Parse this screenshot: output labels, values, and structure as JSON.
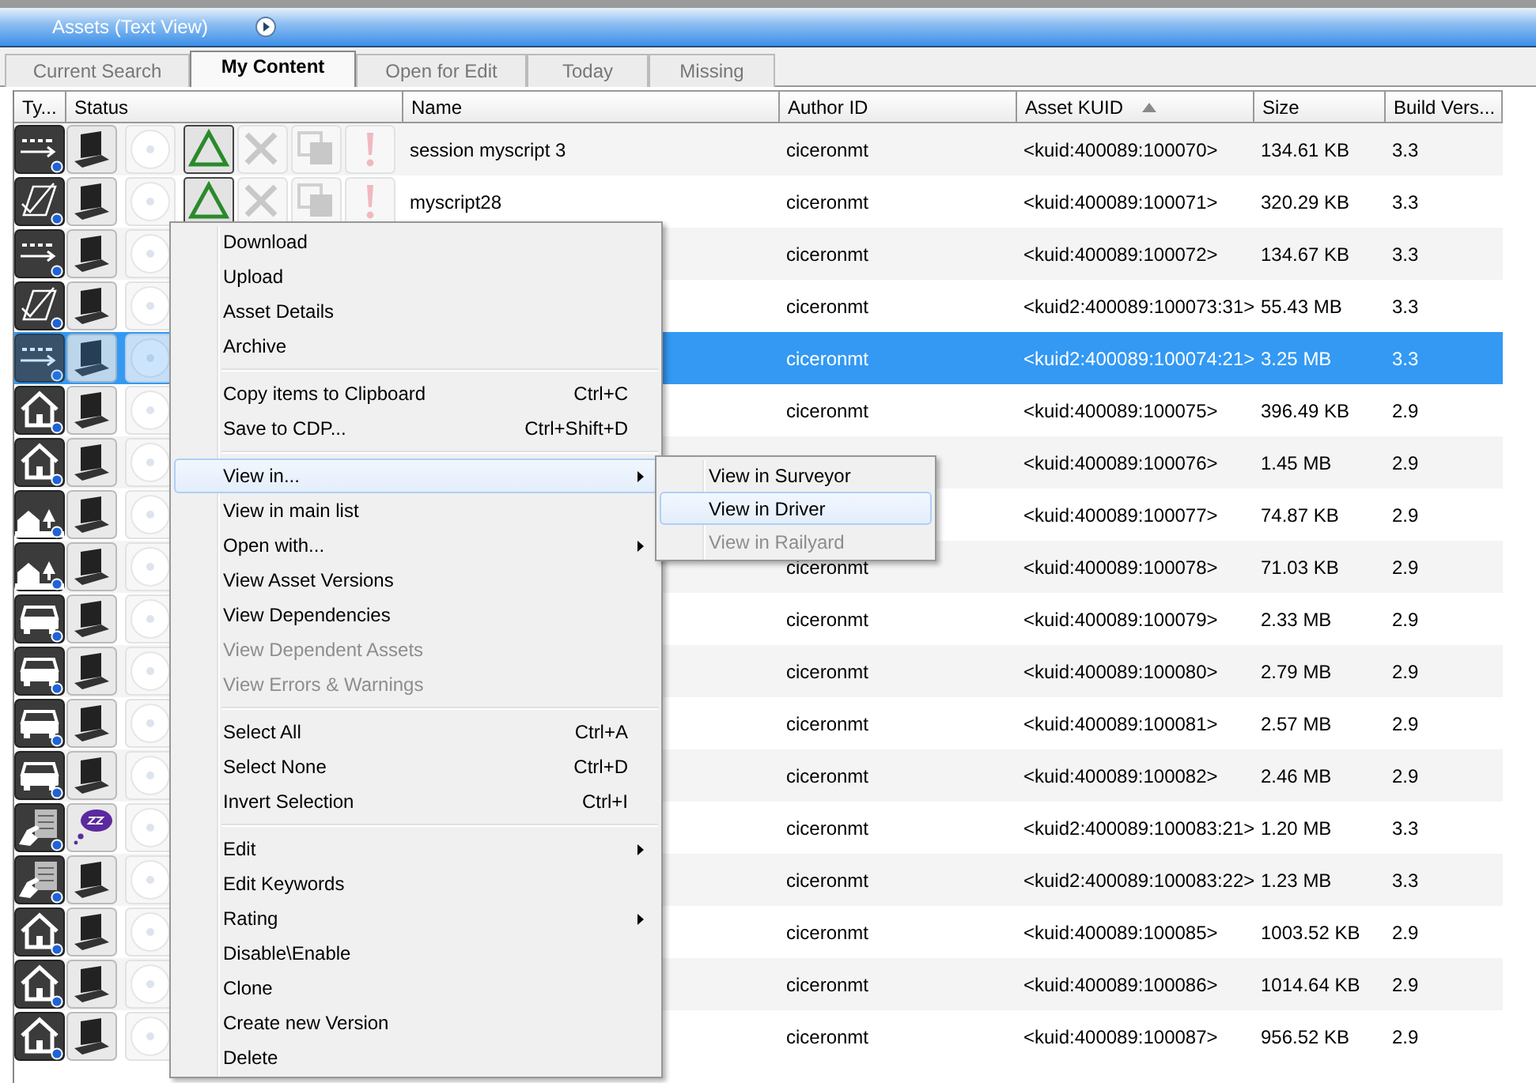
{
  "window": {
    "title": "Assets (Text View)"
  },
  "tabs": [
    {
      "label": "Current Search",
      "selected": false
    },
    {
      "label": "My Content",
      "selected": true
    },
    {
      "label": "Open for Edit",
      "selected": false
    },
    {
      "label": "Today",
      "selected": false
    },
    {
      "label": "Missing",
      "selected": false
    }
  ],
  "table": {
    "columns": [
      {
        "label": "Ty...",
        "sorted": false
      },
      {
        "label": "Status",
        "sorted": false
      },
      {
        "label": "Name",
        "sorted": false
      },
      {
        "label": "Author ID",
        "sorted": false
      },
      {
        "label": "Asset KUID",
        "sorted": true
      },
      {
        "label": "Size",
        "sorted": false
      },
      {
        "label": "Build Vers...",
        "sorted": false
      }
    ],
    "rows": [
      {
        "type_icon": {
          "kind": "script"
        },
        "status_icons": [
          {
            "kind": "laptop"
          },
          {
            "kind": "disc"
          },
          {
            "kind": "triangle"
          },
          {
            "kind": "tools"
          },
          {
            "kind": "copy"
          },
          {
            "kind": "warning"
          }
        ],
        "name": "session myscript 3",
        "author": "ciceronmt",
        "kuid": "<kuid:400089:100070>",
        "size": "134.61 KB",
        "build": "3.3",
        "selected": false
      },
      {
        "type_icon": {
          "kind": "rule"
        },
        "status_icons": [
          {
            "kind": "laptop"
          },
          {
            "kind": "disc"
          },
          {
            "kind": "triangle"
          },
          {
            "kind": "tools"
          },
          {
            "kind": "copy"
          },
          {
            "kind": "warning"
          }
        ],
        "name": "myscript28",
        "author": "ciceronmt",
        "kuid": "<kuid:400089:100071>",
        "size": "320.29 KB",
        "build": "3.3",
        "selected": false
      },
      {
        "type_icon": {
          "kind": "script"
        },
        "status_icons": [
          {
            "kind": "laptop"
          },
          {
            "kind": "disc"
          }
        ],
        "author": "ciceronmt",
        "kuid": "<kuid:400089:100072>",
        "size": "134.67 KB",
        "build": "3.3",
        "selected": false
      },
      {
        "type_icon": {
          "kind": "rule"
        },
        "status_icons": [
          {
            "kind": "laptop"
          },
          {
            "kind": "disc"
          }
        ],
        "author": "ciceronmt",
        "kuid": "<kuid2:400089:100073:31>",
        "size": "55.43 MB",
        "build": "3.3",
        "selected": false
      },
      {
        "type_icon": {
          "kind": "script"
        },
        "status_icons": [
          {
            "kind": "laptop"
          },
          {
            "kind": "disc"
          }
        ],
        "author": "ciceronmt",
        "kuid": "<kuid2:400089:100074:21>",
        "size": "3.25 MB",
        "build": "3.3",
        "selected": true
      },
      {
        "type_icon": {
          "kind": "house"
        },
        "status_icons": [
          {
            "kind": "laptop"
          },
          {
            "kind": "disc"
          }
        ],
        "author": "ciceronmt",
        "kuid": "<kuid:400089:100075>",
        "size": "396.49 KB",
        "build": "2.9",
        "selected": false
      },
      {
        "type_icon": {
          "kind": "house"
        },
        "status_icons": [
          {
            "kind": "laptop"
          },
          {
            "kind": "disc"
          }
        ],
        "kuid": "<kuid:400089:100076>",
        "size": "1.45 MB",
        "build": "2.9",
        "selected": false
      },
      {
        "type_icon": {
          "kind": "village"
        },
        "status_icons": [
          {
            "kind": "laptop"
          },
          {
            "kind": "disc"
          }
        ],
        "kuid": "<kuid:400089:100077>",
        "size": "74.87 KB",
        "build": "2.9",
        "selected": false
      },
      {
        "type_icon": {
          "kind": "village"
        },
        "status_icons": [
          {
            "kind": "laptop"
          },
          {
            "kind": "disc"
          }
        ],
        "author": "ciceronmt",
        "kuid": "<kuid:400089:100078>",
        "size": "71.03 KB",
        "build": "2.9",
        "selected": false
      },
      {
        "type_icon": {
          "kind": "car"
        },
        "status_icons": [
          {
            "kind": "laptop"
          },
          {
            "kind": "disc"
          }
        ],
        "author": "ciceronmt",
        "kuid": "<kuid:400089:100079>",
        "size": "2.33 MB",
        "build": "2.9",
        "selected": false
      },
      {
        "type_icon": {
          "kind": "car"
        },
        "status_icons": [
          {
            "kind": "laptop"
          },
          {
            "kind": "disc"
          }
        ],
        "author": "ciceronmt",
        "kuid": "<kuid:400089:100080>",
        "size": "2.79 MB",
        "build": "2.9",
        "selected": false
      },
      {
        "type_icon": {
          "kind": "car"
        },
        "status_icons": [
          {
            "kind": "laptop"
          },
          {
            "kind": "disc"
          }
        ],
        "author": "ciceronmt",
        "kuid": "<kuid:400089:100081>",
        "size": "2.57 MB",
        "build": "2.9",
        "selected": false
      },
      {
        "type_icon": {
          "kind": "car"
        },
        "status_icons": [
          {
            "kind": "laptop"
          },
          {
            "kind": "disc"
          }
        ],
        "author": "ciceronmt",
        "kuid": "<kuid:400089:100082>",
        "size": "2.46 MB",
        "build": "2.9",
        "selected": false
      },
      {
        "type_icon": {
          "kind": "hand"
        },
        "status_icons": [
          {
            "kind": "sleep"
          },
          {
            "kind": "disc"
          }
        ],
        "author": "ciceronmt",
        "kuid": "<kuid2:400089:100083:21>",
        "size": "1.20 MB",
        "build": "3.3",
        "selected": false
      },
      {
        "type_icon": {
          "kind": "hand"
        },
        "status_icons": [
          {
            "kind": "laptop"
          },
          {
            "kind": "disc"
          }
        ],
        "author": "ciceronmt",
        "kuid": "<kuid2:400089:100083:22>",
        "size": "1.23 MB",
        "build": "3.3",
        "selected": false
      },
      {
        "type_icon": {
          "kind": "house"
        },
        "status_icons": [
          {
            "kind": "laptop"
          },
          {
            "kind": "disc"
          }
        ],
        "author": "ciceronmt",
        "kuid": "<kuid:400089:100085>",
        "size": "1003.52 KB",
        "build": "2.9",
        "selected": false
      },
      {
        "type_icon": {
          "kind": "house"
        },
        "status_icons": [
          {
            "kind": "laptop"
          },
          {
            "kind": "disc"
          }
        ],
        "author": "ciceronmt",
        "kuid": "<kuid:400089:100086>",
        "size": "1014.64 KB",
        "build": "2.9",
        "selected": false
      },
      {
        "type_icon": {
          "kind": "house"
        },
        "status_icons": [
          {
            "kind": "laptop"
          },
          {
            "kind": "disc"
          }
        ],
        "author": "ciceronmt",
        "kuid": "<kuid:400089:100087>",
        "size": "956.52 KB",
        "build": "2.9",
        "selected": false
      }
    ]
  },
  "context_menu": {
    "items": [
      {
        "kind": "item",
        "label": "Download",
        "has_submenu": false,
        "disabled": false,
        "selected": false
      },
      {
        "kind": "item",
        "label": "Upload",
        "has_submenu": false,
        "disabled": false,
        "selected": false
      },
      {
        "kind": "item",
        "label": "Asset Details",
        "has_submenu": false,
        "disabled": false,
        "selected": false
      },
      {
        "kind": "item",
        "label": "Archive",
        "has_submenu": false,
        "disabled": false,
        "selected": false
      },
      {
        "kind": "separator"
      },
      {
        "kind": "item",
        "label": "Copy items to Clipboard",
        "shortcut": "Ctrl+C",
        "has_submenu": false,
        "disabled": false,
        "selected": false
      },
      {
        "kind": "item",
        "label": "Save to CDP...",
        "shortcut": "Ctrl+Shift+D",
        "has_submenu": false,
        "disabled": false,
        "selected": false
      },
      {
        "kind": "separator"
      },
      {
        "kind": "item",
        "label": "View in...",
        "has_submenu": true,
        "disabled": false,
        "selected": true
      },
      {
        "kind": "item",
        "label": "View in main list",
        "has_submenu": false,
        "disabled": false,
        "selected": false
      },
      {
        "kind": "item",
        "label": "Open with...",
        "has_submenu": true,
        "disabled": false,
        "selected": false
      },
      {
        "kind": "item",
        "label": "View Asset Versions",
        "has_submenu": false,
        "disabled": false,
        "selected": false
      },
      {
        "kind": "item",
        "label": "View Dependencies",
        "has_submenu": false,
        "disabled": false,
        "selected": false
      },
      {
        "kind": "item",
        "label": "View Dependent Assets",
        "has_submenu": false,
        "disabled": true,
        "selected": false
      },
      {
        "kind": "item",
        "label": "View Errors & Warnings",
        "has_submenu": false,
        "disabled": true,
        "selected": false
      },
      {
        "kind": "separator"
      },
      {
        "kind": "item",
        "label": "Select All",
        "shortcut": "Ctrl+A",
        "has_submenu": false,
        "disabled": false,
        "selected": false
      },
      {
        "kind": "item",
        "label": "Select None",
        "shortcut": "Ctrl+D",
        "has_submenu": false,
        "disabled": false,
        "selected": false
      },
      {
        "kind": "item",
        "label": "Invert Selection",
        "shortcut": "Ctrl+I",
        "has_submenu": false,
        "disabled": false,
        "selected": false
      },
      {
        "kind": "separator"
      },
      {
        "kind": "item",
        "label": "Edit",
        "has_submenu": true,
        "disabled": false,
        "selected": false
      },
      {
        "kind": "item",
        "label": "Edit Keywords",
        "has_submenu": false,
        "disabled": false,
        "selected": false
      },
      {
        "kind": "item",
        "label": "Rating",
        "has_submenu": true,
        "disabled": false,
        "selected": false
      },
      {
        "kind": "item",
        "label": "Disable\\Enable",
        "has_submenu": false,
        "disabled": false,
        "selected": false
      },
      {
        "kind": "item",
        "label": "Clone",
        "has_submenu": false,
        "disabled": false,
        "selected": false
      },
      {
        "kind": "item",
        "label": "Create new Version",
        "has_submenu": false,
        "disabled": false,
        "selected": false
      },
      {
        "kind": "item",
        "label": "Delete",
        "has_submenu": false,
        "disabled": false,
        "selected": false
      }
    ]
  },
  "submenu": {
    "items": [
      {
        "kind": "item",
        "label": "View in Surveyor",
        "has_submenu": false,
        "disabled": false,
        "selected": false
      },
      {
        "kind": "item",
        "label": "View in Driver",
        "has_submenu": false,
        "disabled": false,
        "selected": true
      },
      {
        "kind": "item",
        "label": "View in Railyard",
        "has_submenu": false,
        "disabled": true,
        "selected": false
      }
    ]
  }
}
